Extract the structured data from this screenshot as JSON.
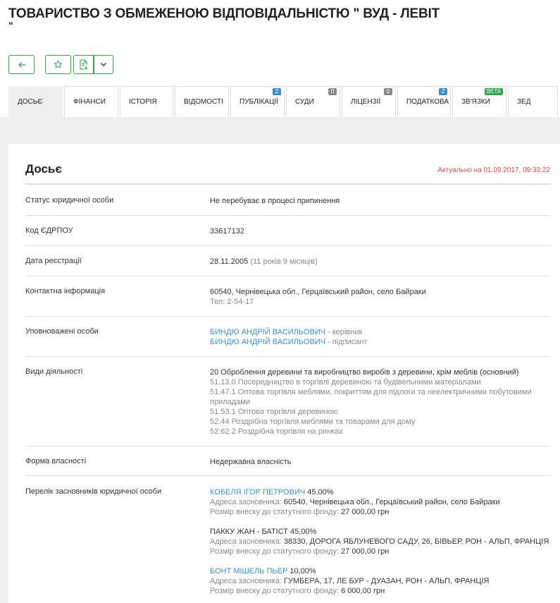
{
  "company": {
    "title": "ТОВАРИСТВО З ОБМЕЖЕНОЮ ВІДПОВІДАЛЬНІСТЮ \" ВУД - ЛЕВІТ",
    "title_tail": "\""
  },
  "tabs": [
    {
      "label": "Досьє"
    },
    {
      "label": "Фінанси"
    },
    {
      "label": "Історія"
    },
    {
      "label": "Відомості"
    },
    {
      "label": "Публікації",
      "badge": "2"
    },
    {
      "label": "Суди",
      "badge": "0"
    },
    {
      "label": "Ліцензії",
      "badge": "0"
    },
    {
      "label": "Податкова",
      "badge": "2"
    },
    {
      "label": "Зв'язки",
      "badge": "beta"
    },
    {
      "label": "ЗЕД"
    }
  ],
  "dossier": {
    "heading": "Досьє",
    "updated": "Актуально на 01.09.2017, 09:33:22",
    "status_label": "Статус юридичної особи",
    "status_value": "Не перебуває в процесі припинення",
    "code_label": "Код ЄДРПОУ",
    "code_value": "33617132",
    "regdate_label": "Дата реєстрації",
    "regdate_value": "28.11.2005",
    "regdate_age": "(11 років 9 місяців)",
    "contact_label": "Контактна інформація",
    "contact_address": "60540, Чернівецька обл., Герцаївський район, село Байраки",
    "contact_phone": "Тел: 2-54-17",
    "persons_label": "Уповноважені особи",
    "person1_name": "БИНДЮ АНДРІЙ ВАСИЛЬОВИЧ",
    "person1_role": " - керівник",
    "person2_name": "БИНДЮ АНДРІЙ ВАСИЛЬОВИЧ",
    "person2_role": " - підписант",
    "activities_label": "Види діяльності",
    "activity_main": "20 Оброблення деревини та виробництво виробів з деревини, крім меблів (основний)",
    "activity_2": "51.13.0 Посередництво в торгівлі деревиною та будівельними матеріалами",
    "activity_3": "51.47.1 Оптова торгівля меблями, покриттям для підлоги та неелектричними побутовими приладами",
    "activity_4": "51.53.1 Оптова торгівля деревиною",
    "activity_5": "52.44 Роздрібна торгівля меблями та товарами для дому",
    "activity_6": "52.62.2 Роздрібна торгівля на ринках",
    "ownership_label": "Форма власності",
    "ownership_value": "Недержавна власність",
    "founders_label": "Перелік засновників юридичної особи",
    "founders": [
      {
        "name": "КОБЕЛЯ ІГОР ПЕТРОВИЧ",
        "share": " 45,00%",
        "addr_label": "Адреса засновника: ",
        "addr": "60540, Чернівецька обл., Герцаївський район, село Байраки",
        "fund_label": "Розмір внеску до статутного фонду: ",
        "fund": "27 000,00 грн"
      },
      {
        "name": "ПАККУ ЖАН - БАТІСТ",
        "share": " 45,00%",
        "addr_label": "Адреса засновника: ",
        "addr": "38330, ДОРОГА ЯБЛУНЕВОГО САДУ, 26, БІВЬЕР, РОН - АЛЬП, ФРАНЦІЯ",
        "fund_label": "Розмір внеску до статутного фонду: ",
        "fund": "27 000,00 грн"
      },
      {
        "name": "БОНТ МІШЕЛЬ ПЬЕР",
        "share": " 10,00%",
        "addr_label": "Адреса засновника: ",
        "addr": "ГУМБЕРА, 17, ЛЕ БУР - ДУАЗАН, РОН - АЛЬП, ФРАНЦІЯ",
        "fund_label": "Розмір внеску до статутного фонду: ",
        "fund": "6 000,00 грн"
      }
    ]
  }
}
